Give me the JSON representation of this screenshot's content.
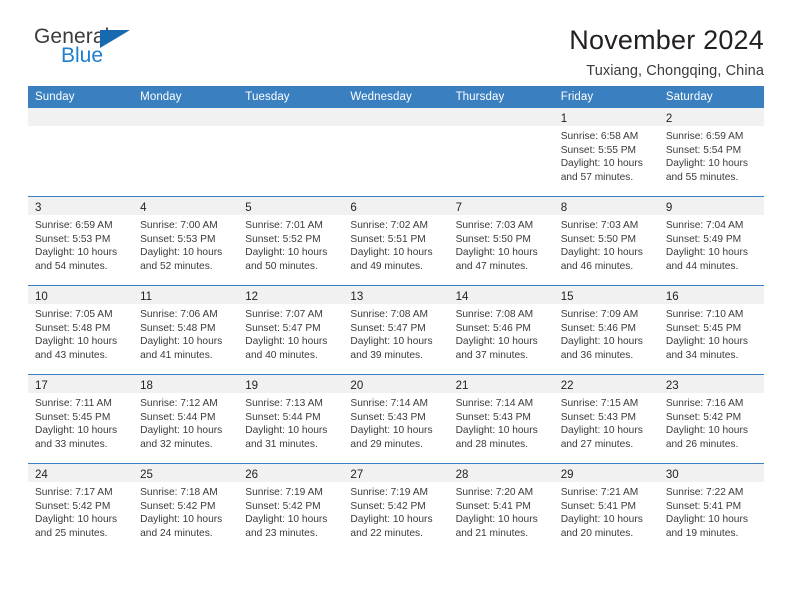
{
  "brand": {
    "name_top": "General",
    "name_bottom": "Blue",
    "accent_color": "#1c7fd0",
    "triangle_color": "#1769b0"
  },
  "header": {
    "title": "November 2024",
    "subtitle": "Tuxiang, Chongqing, China"
  },
  "calendar": {
    "header_bg": "#3a80c1",
    "header_text_color": "#ffffff",
    "daynum_band_bg": "#f1f1f1",
    "weekday_headers": [
      "Sunday",
      "Monday",
      "Tuesday",
      "Wednesday",
      "Thursday",
      "Friday",
      "Saturday"
    ],
    "weeks": [
      [
        {
          "empty": true
        },
        {
          "empty": true
        },
        {
          "empty": true
        },
        {
          "empty": true
        },
        {
          "empty": true
        },
        {
          "day": "1",
          "sunrise": "Sunrise: 6:58 AM",
          "sunset": "Sunset: 5:55 PM",
          "daylight": "Daylight: 10 hours and 57 minutes."
        },
        {
          "day": "2",
          "sunrise": "Sunrise: 6:59 AM",
          "sunset": "Sunset: 5:54 PM",
          "daylight": "Daylight: 10 hours and 55 minutes."
        }
      ],
      [
        {
          "day": "3",
          "sunrise": "Sunrise: 6:59 AM",
          "sunset": "Sunset: 5:53 PM",
          "daylight": "Daylight: 10 hours and 54 minutes."
        },
        {
          "day": "4",
          "sunrise": "Sunrise: 7:00 AM",
          "sunset": "Sunset: 5:53 PM",
          "daylight": "Daylight: 10 hours and 52 minutes."
        },
        {
          "day": "5",
          "sunrise": "Sunrise: 7:01 AM",
          "sunset": "Sunset: 5:52 PM",
          "daylight": "Daylight: 10 hours and 50 minutes."
        },
        {
          "day": "6",
          "sunrise": "Sunrise: 7:02 AM",
          "sunset": "Sunset: 5:51 PM",
          "daylight": "Daylight: 10 hours and 49 minutes."
        },
        {
          "day": "7",
          "sunrise": "Sunrise: 7:03 AM",
          "sunset": "Sunset: 5:50 PM",
          "daylight": "Daylight: 10 hours and 47 minutes."
        },
        {
          "day": "8",
          "sunrise": "Sunrise: 7:03 AM",
          "sunset": "Sunset: 5:50 PM",
          "daylight": "Daylight: 10 hours and 46 minutes."
        },
        {
          "day": "9",
          "sunrise": "Sunrise: 7:04 AM",
          "sunset": "Sunset: 5:49 PM",
          "daylight": "Daylight: 10 hours and 44 minutes."
        }
      ],
      [
        {
          "day": "10",
          "sunrise": "Sunrise: 7:05 AM",
          "sunset": "Sunset: 5:48 PM",
          "daylight": "Daylight: 10 hours and 43 minutes."
        },
        {
          "day": "11",
          "sunrise": "Sunrise: 7:06 AM",
          "sunset": "Sunset: 5:48 PM",
          "daylight": "Daylight: 10 hours and 41 minutes."
        },
        {
          "day": "12",
          "sunrise": "Sunrise: 7:07 AM",
          "sunset": "Sunset: 5:47 PM",
          "daylight": "Daylight: 10 hours and 40 minutes."
        },
        {
          "day": "13",
          "sunrise": "Sunrise: 7:08 AM",
          "sunset": "Sunset: 5:47 PM",
          "daylight": "Daylight: 10 hours and 39 minutes."
        },
        {
          "day": "14",
          "sunrise": "Sunrise: 7:08 AM",
          "sunset": "Sunset: 5:46 PM",
          "daylight": "Daylight: 10 hours and 37 minutes."
        },
        {
          "day": "15",
          "sunrise": "Sunrise: 7:09 AM",
          "sunset": "Sunset: 5:46 PM",
          "daylight": "Daylight: 10 hours and 36 minutes."
        },
        {
          "day": "16",
          "sunrise": "Sunrise: 7:10 AM",
          "sunset": "Sunset: 5:45 PM",
          "daylight": "Daylight: 10 hours and 34 minutes."
        }
      ],
      [
        {
          "day": "17",
          "sunrise": "Sunrise: 7:11 AM",
          "sunset": "Sunset: 5:45 PM",
          "daylight": "Daylight: 10 hours and 33 minutes."
        },
        {
          "day": "18",
          "sunrise": "Sunrise: 7:12 AM",
          "sunset": "Sunset: 5:44 PM",
          "daylight": "Daylight: 10 hours and 32 minutes."
        },
        {
          "day": "19",
          "sunrise": "Sunrise: 7:13 AM",
          "sunset": "Sunset: 5:44 PM",
          "daylight": "Daylight: 10 hours and 31 minutes."
        },
        {
          "day": "20",
          "sunrise": "Sunrise: 7:14 AM",
          "sunset": "Sunset: 5:43 PM",
          "daylight": "Daylight: 10 hours and 29 minutes."
        },
        {
          "day": "21",
          "sunrise": "Sunrise: 7:14 AM",
          "sunset": "Sunset: 5:43 PM",
          "daylight": "Daylight: 10 hours and 28 minutes."
        },
        {
          "day": "22",
          "sunrise": "Sunrise: 7:15 AM",
          "sunset": "Sunset: 5:43 PM",
          "daylight": "Daylight: 10 hours and 27 minutes."
        },
        {
          "day": "23",
          "sunrise": "Sunrise: 7:16 AM",
          "sunset": "Sunset: 5:42 PM",
          "daylight": "Daylight: 10 hours and 26 minutes."
        }
      ],
      [
        {
          "day": "24",
          "sunrise": "Sunrise: 7:17 AM",
          "sunset": "Sunset: 5:42 PM",
          "daylight": "Daylight: 10 hours and 25 minutes."
        },
        {
          "day": "25",
          "sunrise": "Sunrise: 7:18 AM",
          "sunset": "Sunset: 5:42 PM",
          "daylight": "Daylight: 10 hours and 24 minutes."
        },
        {
          "day": "26",
          "sunrise": "Sunrise: 7:19 AM",
          "sunset": "Sunset: 5:42 PM",
          "daylight": "Daylight: 10 hours and 23 minutes."
        },
        {
          "day": "27",
          "sunrise": "Sunrise: 7:19 AM",
          "sunset": "Sunset: 5:42 PM",
          "daylight": "Daylight: 10 hours and 22 minutes."
        },
        {
          "day": "28",
          "sunrise": "Sunrise: 7:20 AM",
          "sunset": "Sunset: 5:41 PM",
          "daylight": "Daylight: 10 hours and 21 minutes."
        },
        {
          "day": "29",
          "sunrise": "Sunrise: 7:21 AM",
          "sunset": "Sunset: 5:41 PM",
          "daylight": "Daylight: 10 hours and 20 minutes."
        },
        {
          "day": "30",
          "sunrise": "Sunrise: 7:22 AM",
          "sunset": "Sunset: 5:41 PM",
          "daylight": "Daylight: 10 hours and 19 minutes."
        }
      ]
    ]
  }
}
